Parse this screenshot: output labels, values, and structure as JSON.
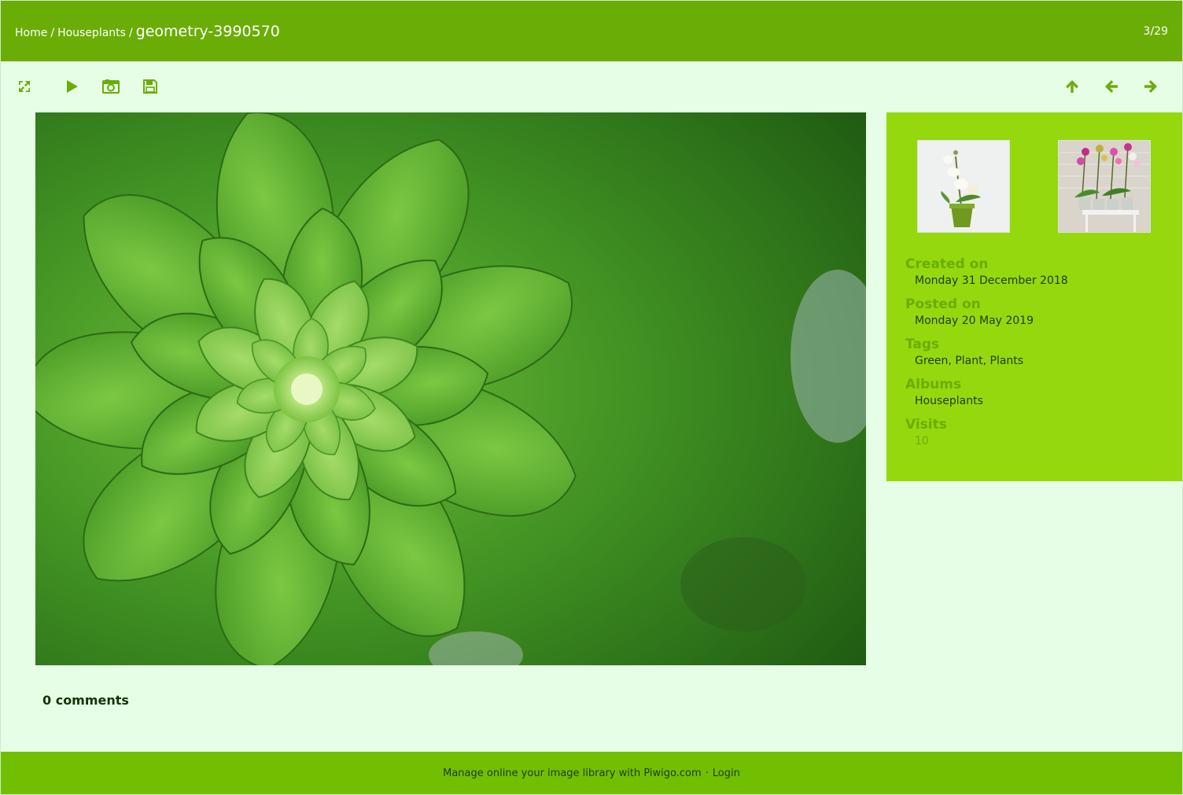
{
  "header": {
    "breadcrumb": {
      "home": "Home",
      "sep1": "/",
      "album": "Houseplants",
      "sep2": "/",
      "current": "geometry-3990570"
    },
    "counter": "3/29"
  },
  "toolbar": {
    "left": [
      {
        "icon": "fullscreen-icon",
        "name": "fullscreen-button"
      },
      {
        "icon": "play-icon",
        "name": "slideshow-button"
      },
      {
        "icon": "camera-icon",
        "name": "show-file-metadata-button"
      },
      {
        "icon": "save-icon",
        "name": "download-button"
      }
    ],
    "right": [
      {
        "icon": "arrow-up-icon",
        "name": "thumbnails-button"
      },
      {
        "icon": "arrow-left-icon",
        "name": "previous-button"
      },
      {
        "icon": "arrow-right-icon",
        "name": "next-button"
      }
    ]
  },
  "info": {
    "created_label": "Created on",
    "created_value": "Monday 31 December 2018",
    "posted_label": "Posted on",
    "posted_value": "Monday 20 May 2019",
    "tags_label": "Tags",
    "tags": [
      "Green",
      "Plant",
      "Plants"
    ],
    "tag_separator": ",",
    "albums_label": "Albums",
    "albums_value": "Houseplants",
    "visits_label": "Visits",
    "visits_value": "10"
  },
  "comments": {
    "label": "0 comments"
  },
  "footer": {
    "text": "Manage online your image library with",
    "link": "Piwigo.com",
    "dot": "·",
    "login": "Login"
  },
  "colors": {
    "header_bg": "#6aad06",
    "page_bg": "#e6fde6",
    "panel_bg": "#95d80e",
    "footer_bg": "#72bf02",
    "accent": "#6aad06"
  }
}
